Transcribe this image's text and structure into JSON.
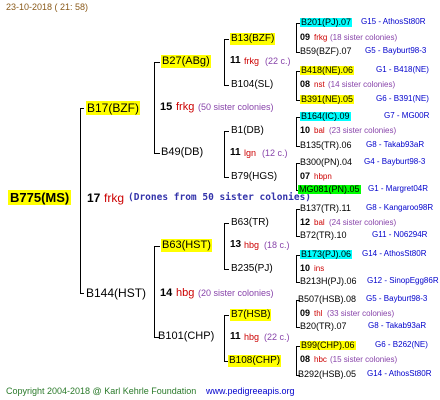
{
  "header": {
    "date": "23-10-2018 ( 21: 58)"
  },
  "footer": {
    "copyright": "Copyright 2004-2018 @ Karl Kehrle Foundation",
    "site": "www.pedigreeapis.org"
  },
  "root": {
    "id": "B775(MS)",
    "num": "17",
    "word": "frkg",
    "note": "(Drones from 50 sister colonies)"
  },
  "gen1": [
    {
      "id": "B17(BZF)",
      "num": "15",
      "word": "frkg",
      "note": "(50 sister colonies)"
    },
    {
      "id": "B144(HST)",
      "num": "14",
      "word": "hbg",
      "note": "(20 sister colonies)"
    }
  ],
  "gen2": [
    {
      "id": "B27(ABg)",
      "num": "11",
      "word": "frkg",
      "note": "(22 c.)"
    },
    {
      "id": "B49(DB)",
      "num": "11",
      "word": "lgn",
      "note": "(12 c.)"
    },
    {
      "id": "B63(HST)",
      "num": "13",
      "word": "hbg",
      "note": "(18 c.)"
    },
    {
      "id": "B101(CHP)",
      "num": "11",
      "word": "hbg",
      "note": "(22 c.)"
    }
  ],
  "gen3": [
    {
      "id": "B13(BZF)",
      "num": "11",
      "word": "frkg",
      "note": "(22 c.)"
    },
    {
      "id": "B104(SL)",
      "num": "",
      "word": "",
      "note": ""
    },
    {
      "id": "B1(DB)",
      "num": "",
      "word": "",
      "note": ""
    },
    {
      "id": "B79(HGS)",
      "num": "",
      "word": "",
      "note": ""
    },
    {
      "id": "B63(TR)",
      "num": "",
      "word": "",
      "note": ""
    },
    {
      "id": "B235(PJ)",
      "num": "",
      "word": "",
      "note": ""
    },
    {
      "id": "B7(HSB)",
      "num": "",
      "word": "",
      "note": ""
    },
    {
      "id": "B108(CHP)",
      "num": "",
      "word": "",
      "note": ""
    }
  ],
  "gen4": [
    {
      "id": "B201(PJ).07",
      "num": "09",
      "word": "frkg",
      "note": "(18 sister colonies)",
      "ref": "G15 - AthosSt80R"
    },
    {
      "id": "B59(BZF).07",
      "num": "",
      "word": "",
      "note": "",
      "ref": "G5 - Bayburt98-3"
    },
    {
      "id": "B418(NE).06",
      "num": "08",
      "word": "nst",
      "note": "(14 sister colonies)",
      "ref": "G1 - B418(NE)"
    },
    {
      "id": "B391(NE).05",
      "num": "",
      "word": "",
      "note": "",
      "ref": "G6 - B391(NE)"
    },
    {
      "id": "B164(IC).09",
      "num": "10",
      "word": "bal",
      "note": "(23 sister colonies)",
      "ref": "G7 - MG00R"
    },
    {
      "id": "B135(TR).06",
      "num": "",
      "word": "",
      "note": "",
      "ref": "G8 - Takab93aR"
    },
    {
      "id": "B300(PN).04",
      "num": "07",
      "word": "hbpn",
      "note": "",
      "ref": "G4 - Bayburt98-3"
    },
    {
      "id": "MG081(PN).05",
      "num": "",
      "word": "",
      "note": "",
      "ref": "G1 - Margret04R"
    },
    {
      "id": "B137(TR).11",
      "num": "12",
      "word": "bal",
      "note": "(24 sister colonies)",
      "ref": "G8 - Kangaroo98R"
    },
    {
      "id": "B72(TR).10",
      "num": "",
      "word": "",
      "note": "",
      "ref": "G11 - N06294R"
    },
    {
      "id": "B173(PJ).06",
      "num": "10",
      "word": "ins",
      "note": "",
      "ref": "G14 - AthosSt80R"
    },
    {
      "id": "B213H(PJ).06",
      "num": "",
      "word": "",
      "note": "",
      "ref": "G12 - SinopEgg86R"
    },
    {
      "id": "B507(HSB).08",
      "num": "09",
      "word": "thl",
      "note": "(33 sister colonies)",
      "ref": "G5 - Bayburt98-3"
    },
    {
      "id": "B20(TR).07",
      "num": "",
      "word": "",
      "note": "",
      "ref": "G8 - Takab93aR"
    },
    {
      "id": "B99(CHP).06",
      "num": "08",
      "word": "hbc",
      "note": "(15 sister colonies)",
      "ref": "G6 - B262(NE)"
    },
    {
      "id": "B292(HSB).05",
      "num": "",
      "word": "",
      "note": "",
      "ref": "G14 - AthosSt80R"
    }
  ]
}
